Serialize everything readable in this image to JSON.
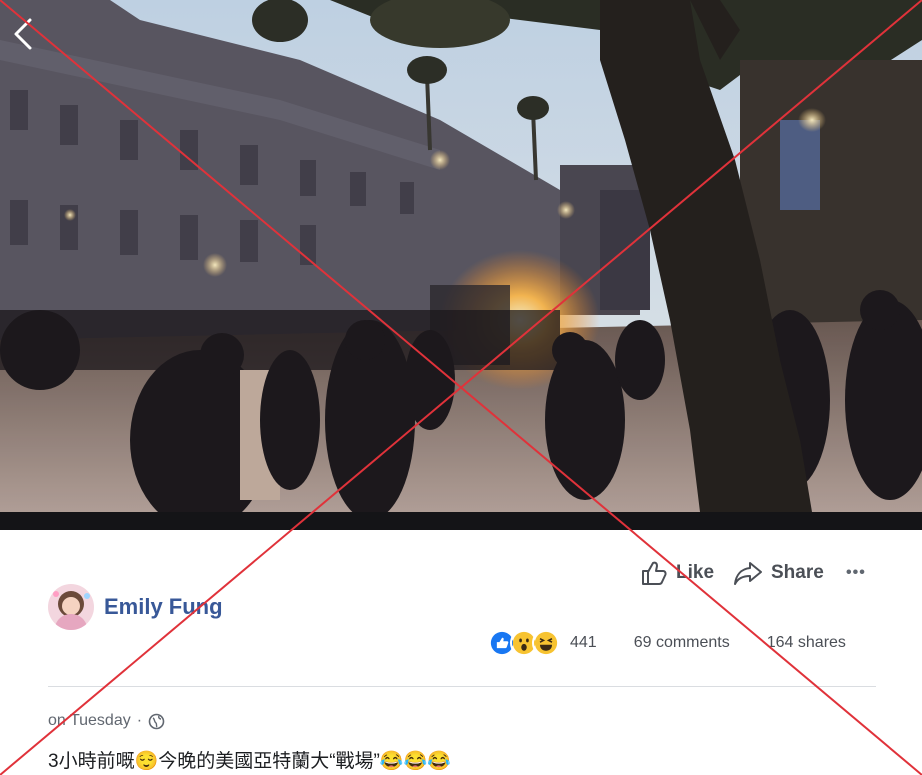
{
  "post": {
    "author": "Emily Fung",
    "timestamp": "on Tuesday",
    "separator": "·",
    "text": "3小時前嘅😌今晚的美國亞特蘭大“戰場”😂😂😂"
  },
  "actions": {
    "like_label": "Like",
    "share_label": "Share",
    "more_label": "•••"
  },
  "stats": {
    "reaction_count": "441",
    "comments": "69 comments",
    "shares": "164 shares"
  },
  "icons": {
    "back": "chevron-left-icon",
    "like": "thumbs-up-icon",
    "share": "share-arrow-icon",
    "audience": "globe-icon",
    "reactions": [
      "like-reaction-icon",
      "wow-reaction-icon",
      "haha-reaction-icon"
    ]
  },
  "colors": {
    "link_blue": "#385898",
    "like_blue": "#1877f2",
    "overlay_red": "#e0323a"
  }
}
